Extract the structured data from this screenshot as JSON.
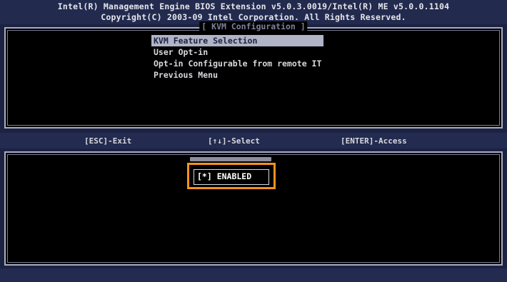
{
  "header": {
    "line1": "Intel(R) Management Engine BIOS Extension v5.0.3.0019/Intel(R) ME v5.0.0.1104",
    "line2": "Copyright(C) 2003-09 Intel Corporation.  All Rights Reserved."
  },
  "panel": {
    "title": "[ KVM Configuration ]"
  },
  "menu": {
    "items": [
      {
        "label": "KVM Feature Selection",
        "selected": true
      },
      {
        "label": "User Opt-in"
      },
      {
        "label": "Opt-in Configurable from remote IT"
      },
      {
        "label": "Previous Menu"
      }
    ]
  },
  "status": {
    "esc": "[ESC]-Exit",
    "select": "[↑↓]-Select",
    "enter": "[ENTER]-Access"
  },
  "popup": {
    "option": "[*] ENABLED"
  },
  "colors": {
    "background": "#1b2242",
    "highlight": "#b1b4c6",
    "callout": "#f5921e"
  }
}
